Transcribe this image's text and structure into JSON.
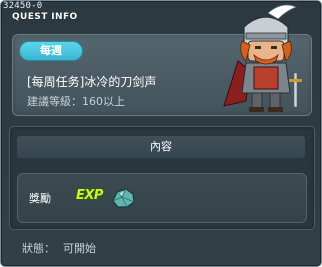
{
  "window": {
    "quest_id": "32450-0",
    "title": "QUEST INFO"
  },
  "quest": {
    "cycle_badge": "每週",
    "name": "[每周任务]冰冷的刀剑声",
    "level_requirement": "建議等級：160以上"
  },
  "content": {
    "header_label": "內容",
    "reward_label": "獎勵",
    "reward_items": [
      {
        "icon": "exp-icon",
        "text": "EXP"
      },
      {
        "icon": "frozen-ore-icon"
      }
    ]
  },
  "status": {
    "label": "狀態：",
    "value": "可開始"
  },
  "colors": {
    "window_bg": "#2e3b43",
    "badge": "#4bc6df",
    "exp": "#c8f23c"
  }
}
